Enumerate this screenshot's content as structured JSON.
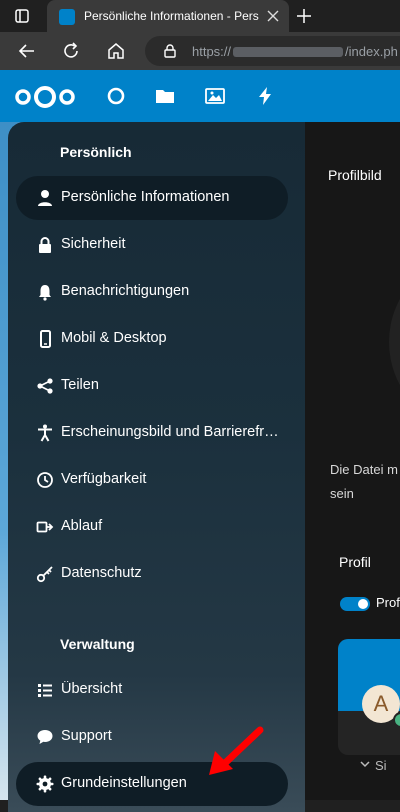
{
  "browser": {
    "tab_title": "Persönliche Informationen - Persö",
    "url_prefix": "https://",
    "url_suffix": "/index.ph"
  },
  "sidebar": {
    "section_personal": "Persönlich",
    "section_admin": "Verwaltung",
    "personal_items": [
      {
        "label": "Persönliche Informationen",
        "icon": "user-icon",
        "active": true
      },
      {
        "label": "Sicherheit",
        "icon": "lock-icon"
      },
      {
        "label": "Benachrichtigungen",
        "icon": "bell-icon"
      },
      {
        "label": "Mobil & Desktop",
        "icon": "phone-icon"
      },
      {
        "label": "Teilen",
        "icon": "share-icon"
      },
      {
        "label": "Erscheinungsbild und Barrierefreiheit",
        "icon": "accessibility-icon"
      },
      {
        "label": "Verfügbarkeit",
        "icon": "clock-icon"
      },
      {
        "label": "Ablauf",
        "icon": "flow-icon"
      },
      {
        "label": "Datenschutz",
        "icon": "key-icon"
      }
    ],
    "admin_items": [
      {
        "label": "Übersicht",
        "icon": "list-icon"
      },
      {
        "label": "Support",
        "icon": "chat-icon"
      },
      {
        "label": "Grundeinstellungen",
        "icon": "gear-icon"
      }
    ]
  },
  "main": {
    "profilbild": "Profilbild",
    "info_line1": "Die Datei m",
    "info_line2": "sein",
    "profil_title": "Profil",
    "toggle_label": "Profi",
    "avatar_letter": "A",
    "more_label": "Si"
  },
  "colors": {
    "brand": "#0082c9",
    "annotation": "#ff0000"
  }
}
